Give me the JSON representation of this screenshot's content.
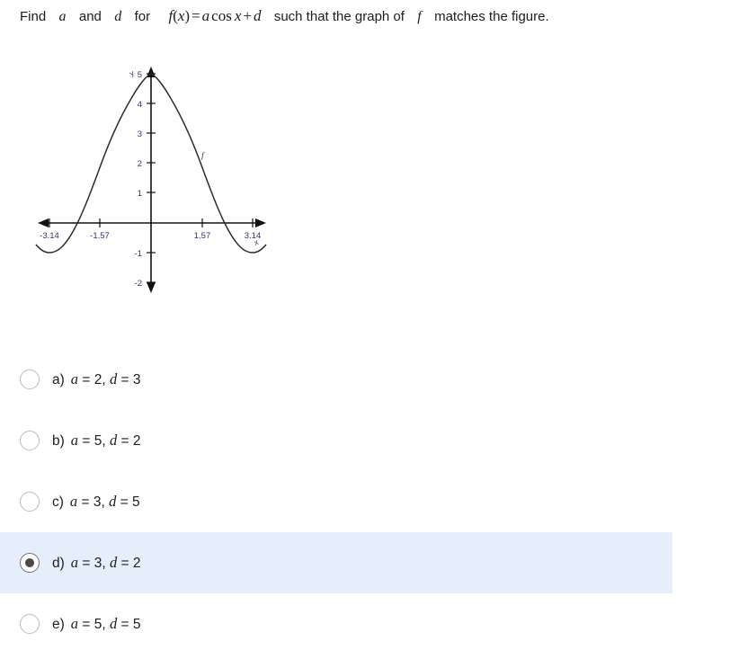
{
  "question": {
    "prefix": "Find",
    "var_a": "a",
    "conj": "and",
    "var_d": "d",
    "for_word": "for",
    "formula": {
      "fn": "f",
      "open": "(",
      "arg": "x",
      "close": ")",
      "equals": "=",
      "coef": "a",
      "cos": "cos",
      "cos_arg": "x",
      "plus": "+",
      "const": "d"
    },
    "suffix_1": "such that the graph of",
    "var_f": "f",
    "suffix_2": "matches the figure."
  },
  "figure": {
    "curve_label": "f",
    "x_axis_label": "x",
    "y_axis_label": "y",
    "x_tick_labels": [
      "-3.14",
      "-1.57",
      "1.57",
      "3.14"
    ],
    "y_tick_labels": [
      "5",
      "4",
      "3",
      "2",
      "1",
      "-1",
      "-2"
    ]
  },
  "chart_data": {
    "type": "line",
    "title": "",
    "xlabel": "x",
    "ylabel": "y",
    "function": "f(x) = 3 cos x + 2",
    "amplitude": 3,
    "vertical_shift": 2,
    "xlim": [
      -3.6,
      3.6
    ],
    "ylim": [
      -2.3,
      5.4
    ],
    "xticks": [
      -3.14,
      -1.57,
      1.57,
      3.14
    ],
    "xtick_labels": [
      "-3.14",
      "-1.57",
      "1.57",
      "3.14"
    ],
    "yticks": [
      5,
      4,
      3,
      2,
      1,
      -1,
      -2
    ],
    "ytick_labels": [
      "5",
      "4",
      "3",
      "2",
      "1",
      "-1",
      "-2"
    ],
    "grid": false,
    "legend": false,
    "series": [
      {
        "name": "f",
        "x": [
          -3.6,
          -3.14,
          -2.8,
          -2.4,
          -2.0,
          -1.57,
          -1.2,
          -0.8,
          -0.4,
          0,
          0.4,
          0.8,
          1.2,
          1.57,
          2.0,
          2.4,
          2.8,
          3.14,
          3.6
        ],
        "y": [
          -0.73,
          -1.0,
          -0.83,
          -0.21,
          0.75,
          2.0,
          3.09,
          4.09,
          4.76,
          5.0,
          4.76,
          4.09,
          3.09,
          2.0,
          0.75,
          -0.21,
          -0.83,
          -1.0,
          -0.73
        ]
      }
    ],
    "annotations": [
      {
        "text": "f",
        "x": 1.1,
        "y": 3.35
      }
    ]
  },
  "options": [
    {
      "letter": "a)",
      "a_var": "a",
      "a_eq": "=",
      "a_val": "2",
      "comma": ",",
      "d_var": "d",
      "d_eq": "=",
      "d_val": "3",
      "selected": false
    },
    {
      "letter": "b)",
      "a_var": "a",
      "a_eq": "=",
      "a_val": "5",
      "comma": ",",
      "d_var": "d",
      "d_eq": "=",
      "d_val": "2",
      "selected": false
    },
    {
      "letter": "c)",
      "a_var": "a",
      "a_eq": "=",
      "a_val": "3",
      "comma": ",",
      "d_var": "d",
      "d_eq": "=",
      "d_val": "5",
      "selected": false
    },
    {
      "letter": "d)",
      "a_var": "a",
      "a_eq": "=",
      "a_val": "3",
      "comma": ",",
      "d_var": "d",
      "d_eq": "=",
      "d_val": "2",
      "selected": true
    },
    {
      "letter": "e)",
      "a_var": "a",
      "a_eq": "=",
      "a_val": "5",
      "comma": ",",
      "d_var": "d",
      "d_eq": "=",
      "d_val": "5",
      "selected": false
    }
  ],
  "colors": {
    "selected_row_background": "#e5eefa",
    "radio_border": "#b9bcc2",
    "radio_dot": "#4a4a4a",
    "text": "#1d1d1d",
    "tick_label": "#3b3b6b",
    "curve": "#2b2b2b"
  }
}
